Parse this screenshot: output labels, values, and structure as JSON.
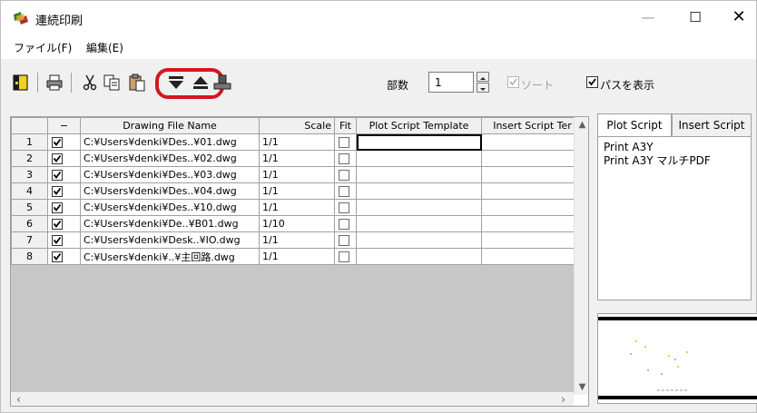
{
  "window": {
    "title": "連続印刷",
    "minimize": "—",
    "maximize": "☐",
    "close": "✕"
  },
  "menu": {
    "items": [
      "ファイル(F)",
      "編集(E)"
    ]
  },
  "toolbar": {
    "copies_label": "部数",
    "copies_value": "1",
    "sort_label": "ソート",
    "sort_checked": true,
    "show_path_label": "パスを表示",
    "show_path_checked": true,
    "highlight_color": "#d6161f"
  },
  "grid": {
    "headers": [
      "",
      "−",
      "Drawing File Name",
      "Scale",
      "Fit",
      "Plot Script Template",
      "Insert Script Ter"
    ],
    "rows": [
      {
        "num": "1",
        "checked": true,
        "file": "C:¥Users¥denki¥Des..¥01.dwg",
        "scale": "1/1",
        "fit": false
      },
      {
        "num": "2",
        "checked": true,
        "file": "C:¥Users¥denki¥Des..¥02.dwg",
        "scale": "1/1",
        "fit": false
      },
      {
        "num": "3",
        "checked": true,
        "file": "C:¥Users¥denki¥Des..¥03.dwg",
        "scale": "1/1",
        "fit": false
      },
      {
        "num": "4",
        "checked": true,
        "file": "C:¥Users¥denki¥Des..¥04.dwg",
        "scale": "1/1",
        "fit": false
      },
      {
        "num": "5",
        "checked": true,
        "file": "C:¥Users¥denki¥Des..¥10.dwg",
        "scale": "1/1",
        "fit": false
      },
      {
        "num": "6",
        "checked": true,
        "file": "C:¥Users¥denki¥De..¥B01.dwg",
        "scale": "1/10",
        "fit": false
      },
      {
        "num": "7",
        "checked": true,
        "file": "C:¥Users¥denki¥Desk..¥IO.dwg",
        "scale": "1/1",
        "fit": false
      },
      {
        "num": "8",
        "checked": true,
        "file": "C:¥Users¥denki¥..¥主回路.dwg",
        "scale": "1/1",
        "fit": false
      }
    ]
  },
  "panel": {
    "tabs": [
      "Plot Script",
      "Insert Script"
    ],
    "active_tab": "Plot Script",
    "scripts": [
      "Print A3Y",
      "Print A3Y マルチPDF"
    ]
  }
}
